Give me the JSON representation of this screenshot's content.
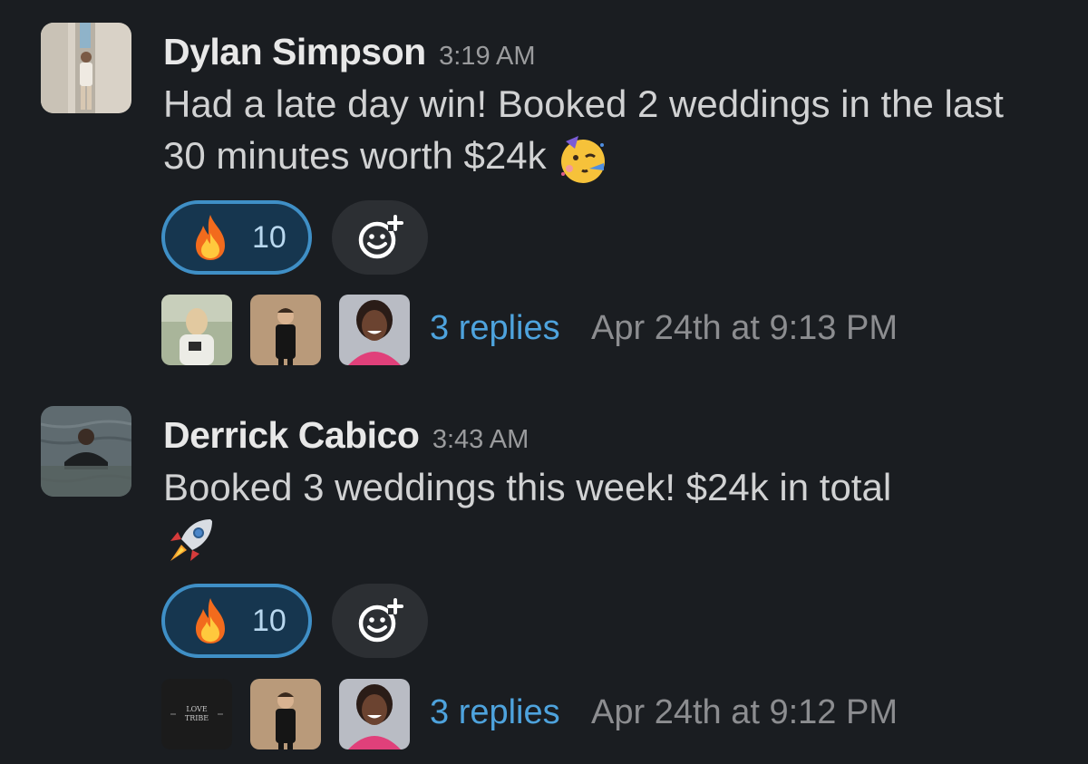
{
  "messages": [
    {
      "author": "Dylan Simpson",
      "time": "3:19 AM",
      "text": "Had a late day win! Booked 2 weddings in the last 30 minutes worth $24k",
      "emoji": "partying-face-icon",
      "reaction": {
        "emoji": "fire-icon",
        "count": "10"
      },
      "thread": {
        "replies": "3 replies",
        "last_reply": "Apr 24th at 9:13 PM"
      }
    },
    {
      "author": "Derrick Cabico",
      "time": "3:43 AM",
      "text": "Booked 3 weddings this week! $24k in total",
      "emoji": "rocket-icon",
      "reaction": {
        "emoji": "fire-icon",
        "count": "10"
      },
      "thread": {
        "replies": "3 replies",
        "last_reply": "Apr 24th at 9:12 PM"
      },
      "logo_avatar_text": "LOVE TRIBE"
    }
  ],
  "colors": {
    "background": "#1a1d21",
    "link": "#4ea3dd",
    "reaction_border": "#3f8fc6",
    "reaction_bg": "#16364f"
  }
}
